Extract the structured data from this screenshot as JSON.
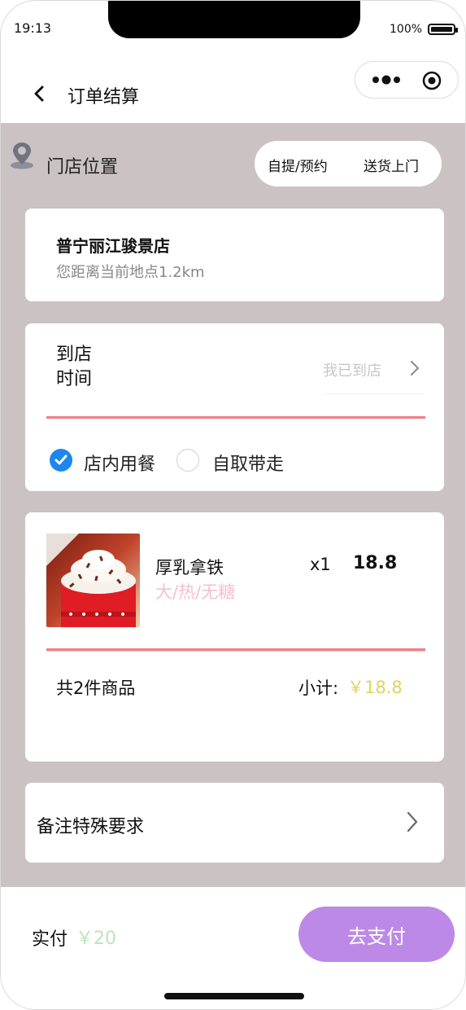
{
  "status_bar": {
    "time": "19:13",
    "battery_percent": "100%"
  },
  "navbar": {
    "title": "订单结算",
    "icons": [
      "back-chevron-icon",
      "more-dots-icon",
      "target-icon"
    ]
  },
  "location": {
    "label": "门店位置",
    "icon": "map-pin-icon",
    "modes": [
      "自提/预约",
      "送货上门"
    ]
  },
  "store": {
    "name": "普宁丽江骏景店",
    "distance": "您距离当前地点1.2km"
  },
  "pickup": {
    "time_label": "到店时间",
    "arrived_placeholder": "我已到店",
    "options": [
      {
        "label": "店内用餐",
        "checked": true
      },
      {
        "label": "自取带走",
        "checked": false
      }
    ],
    "check_color": "#1e86ef"
  },
  "order": {
    "items": [
      {
        "name": "厚乳拿铁",
        "spec": "大/热/无糖",
        "qty": "x1",
        "price": "18.8",
        "image": "latte-cup-image"
      }
    ],
    "count_text": "共2件商品",
    "subtotal_label": "小计:",
    "subtotal_value": "￥18.8"
  },
  "notes": {
    "label": "备注特殊要求"
  },
  "footer": {
    "paid_label": "实付",
    "paid_value": "￥20",
    "pay_button": "去支付",
    "pay_color": "#bc8ae6"
  }
}
